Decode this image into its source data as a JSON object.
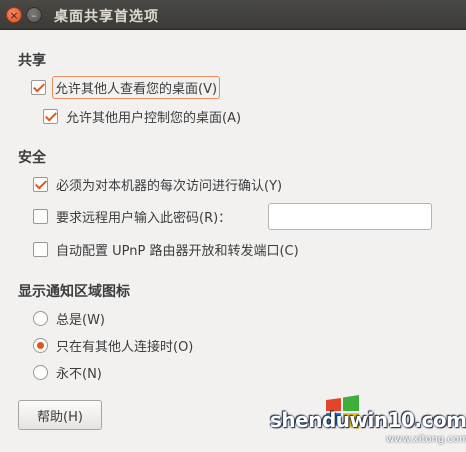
{
  "window": {
    "title": "桌面共享首选项",
    "close_glyph": "×",
    "minimize_glyph": "–"
  },
  "sharing": {
    "heading": "共享",
    "allow_view": {
      "label": "允许其他人查看您的桌面(V)",
      "checked": true
    },
    "allow_control": {
      "label": "允许其他用户控制您的桌面(A)",
      "checked": true
    }
  },
  "security": {
    "heading": "安全",
    "confirm": {
      "label": "必须为对本机器的每次访问进行确认(Y)",
      "checked": true
    },
    "password": {
      "label": "要求远程用户输入此密码(R)：",
      "checked": false,
      "value": ""
    },
    "upnp": {
      "label": "自动配置 UPnP 路由器开放和转发端口(C)",
      "checked": false
    }
  },
  "notification": {
    "heading": "显示通知区域图标",
    "options": [
      {
        "label": "总是(W)",
        "selected": false
      },
      {
        "label": "只在有其他人连接时(O)",
        "selected": true
      },
      {
        "label": "永不(N)",
        "selected": false
      }
    ]
  },
  "buttons": {
    "help": "帮助(H)"
  },
  "watermark": {
    "text": "shenduwin10.com",
    "url": "www.xitong.com"
  },
  "colors": {
    "accent": "#e0571e",
    "titlebar": "#3b3a37",
    "background": "#f2f1f0"
  }
}
